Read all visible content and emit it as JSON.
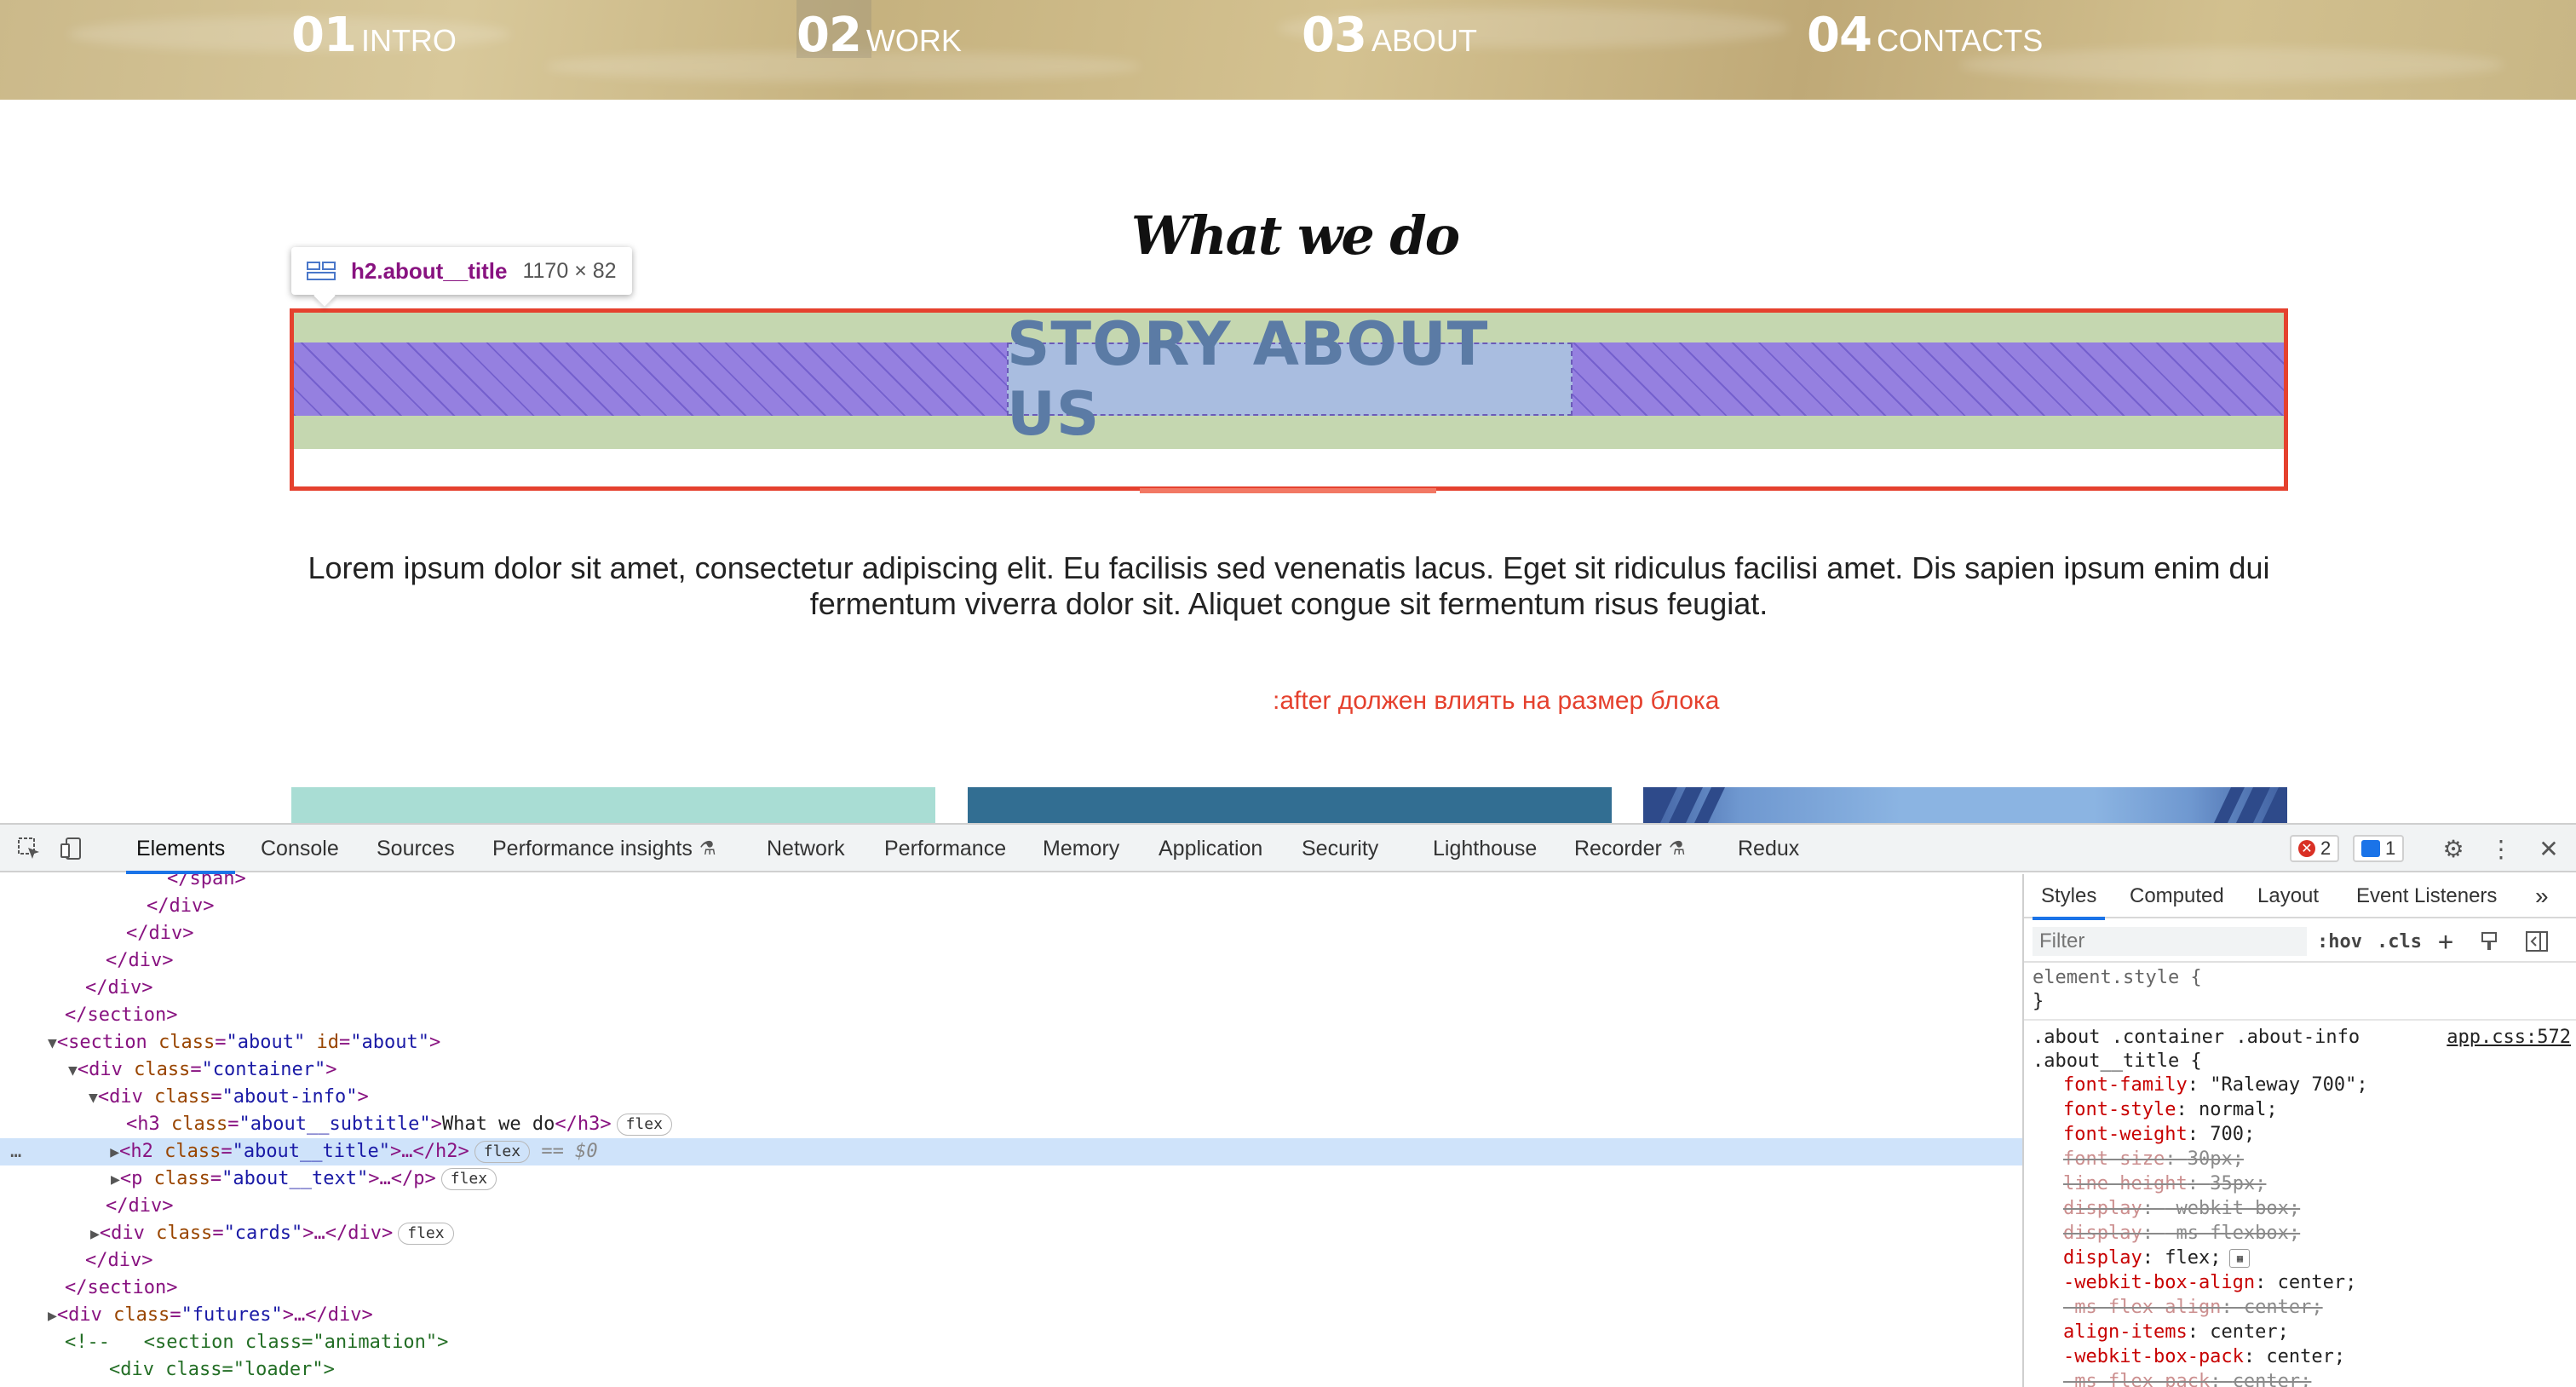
{
  "page": {
    "nav": [
      {
        "num": "01",
        "label": "INTRO"
      },
      {
        "num": "02",
        "label": "WORK"
      },
      {
        "num": "03",
        "label": "ABOUT"
      },
      {
        "num": "04",
        "label": "CONTACTS"
      }
    ],
    "about_subtitle": "What we do",
    "about_title": "STORY ABOUT US",
    "about_text": "Lorem ipsum dolor sit amet, consectetur adipiscing elit. Eu facilisis sed venenatis lacus. Eget sit ridiculus facilisi amet. Dis sapien ipsum enim dui fermentum viverra dolor sit. Aliquet congue sit fermentum risus feugiat.",
    "after_note": ":after должен влиять на размер блока",
    "tooltip": {
      "selector": "h2.about__title",
      "size": "1170 × 82"
    }
  },
  "devtools": {
    "tabs": [
      "Elements",
      "Console",
      "Sources",
      "Performance insights",
      "Network",
      "Performance",
      "Memory",
      "Application",
      "Security",
      "Lighthouse",
      "Recorder",
      "Redux"
    ],
    "active_tab": "Elements",
    "error_count": "2",
    "message_count": "1",
    "dom": {
      "l0": "</span>",
      "l1": "</div>",
      "l2": "</div>",
      "l3": "</div>",
      "l4": "</div>",
      "l5": "</section>",
      "l6_tag": "<section",
      "l6_a1": "class",
      "l6_v1": "\"about\"",
      "l6_a2": "id",
      "l6_v2": "\"about\"",
      "l7_tag": "<div",
      "l7_a1": "class",
      "l7_v1": "\"container\"",
      "l8_tag": "<div",
      "l8_a1": "class",
      "l8_v1": "\"about-info\"",
      "l9_tag": "<h3",
      "l9_a1": "class",
      "l9_v1": "\"about__subtitle\"",
      "l9_text": "What we do",
      "l9_close": "</h3>",
      "l10_tag": "<h2",
      "l10_a1": "class",
      "l10_v1": "\"about__title\"",
      "l10_rest": ">…</h2>",
      "l10_eq": "== $0",
      "l11_tag": "<p",
      "l11_a1": "class",
      "l11_v1": "\"about__text\"",
      "l11_rest": ">…</p>",
      "l12": "</div>",
      "l13_tag": "<div",
      "l13_a1": "class",
      "l13_v1": "\"cards\"",
      "l13_rest": ">…</div>",
      "l14": "</div>",
      "l15": "</section>",
      "l16_tag": "<div",
      "l16_a1": "class",
      "l16_v1": "\"futures\"",
      "l16_rest": ">…</div>",
      "l17": "<!--   <section class=\"animation\">",
      "l18": "<div class=\"loader\">",
      "pill": "flex",
      "dots": "…"
    },
    "styles": {
      "tabs": [
        "Styles",
        "Computed",
        "Layout",
        "Event Listeners"
      ],
      "filter_placeholder": "Filter",
      "hov": ":hov",
      "cls": ".cls",
      "element_style": "element.style {",
      "element_close": "}",
      "selector_line1": ".about .container .about-info",
      "selector_line2": ".about__title {",
      "source": "app.css:572",
      "props": [
        {
          "name": "font-family",
          "value": "\"Raleway 700\";",
          "struck": false
        },
        {
          "name": "font-style",
          "value": "normal;",
          "struck": false
        },
        {
          "name": "font-weight",
          "value": "700;",
          "struck": false
        },
        {
          "name": "font-size",
          "value": "30px;",
          "struck": true
        },
        {
          "name": "line-height",
          "value": "35px;",
          "struck": true
        },
        {
          "name": "display",
          "value": "-webkit-box;",
          "struck": true
        },
        {
          "name": "display",
          "value": "-ms-flexbox;",
          "struck": true
        },
        {
          "name": "display",
          "value": "flex;",
          "struck": false
        },
        {
          "name": "-webkit-box-align",
          "value": "center;",
          "struck": false
        },
        {
          "name": "-ms-flex-align",
          "value": "center;",
          "struck": true
        },
        {
          "name": "align-items",
          "value": "center;",
          "struck": false
        },
        {
          "name": "-webkit-box-pack",
          "value": "center;",
          "struck": false
        },
        {
          "name": "-ms-flex-pack",
          "value": "center;",
          "struck": true
        }
      ]
    }
  },
  "colors": {
    "highlight_outline": "#e5412e",
    "margin_fill": "#c5d7b0",
    "content_fill": "#9580e0",
    "selection_row": "#cfe3fa",
    "devtools_accent": "#1a73e8"
  }
}
